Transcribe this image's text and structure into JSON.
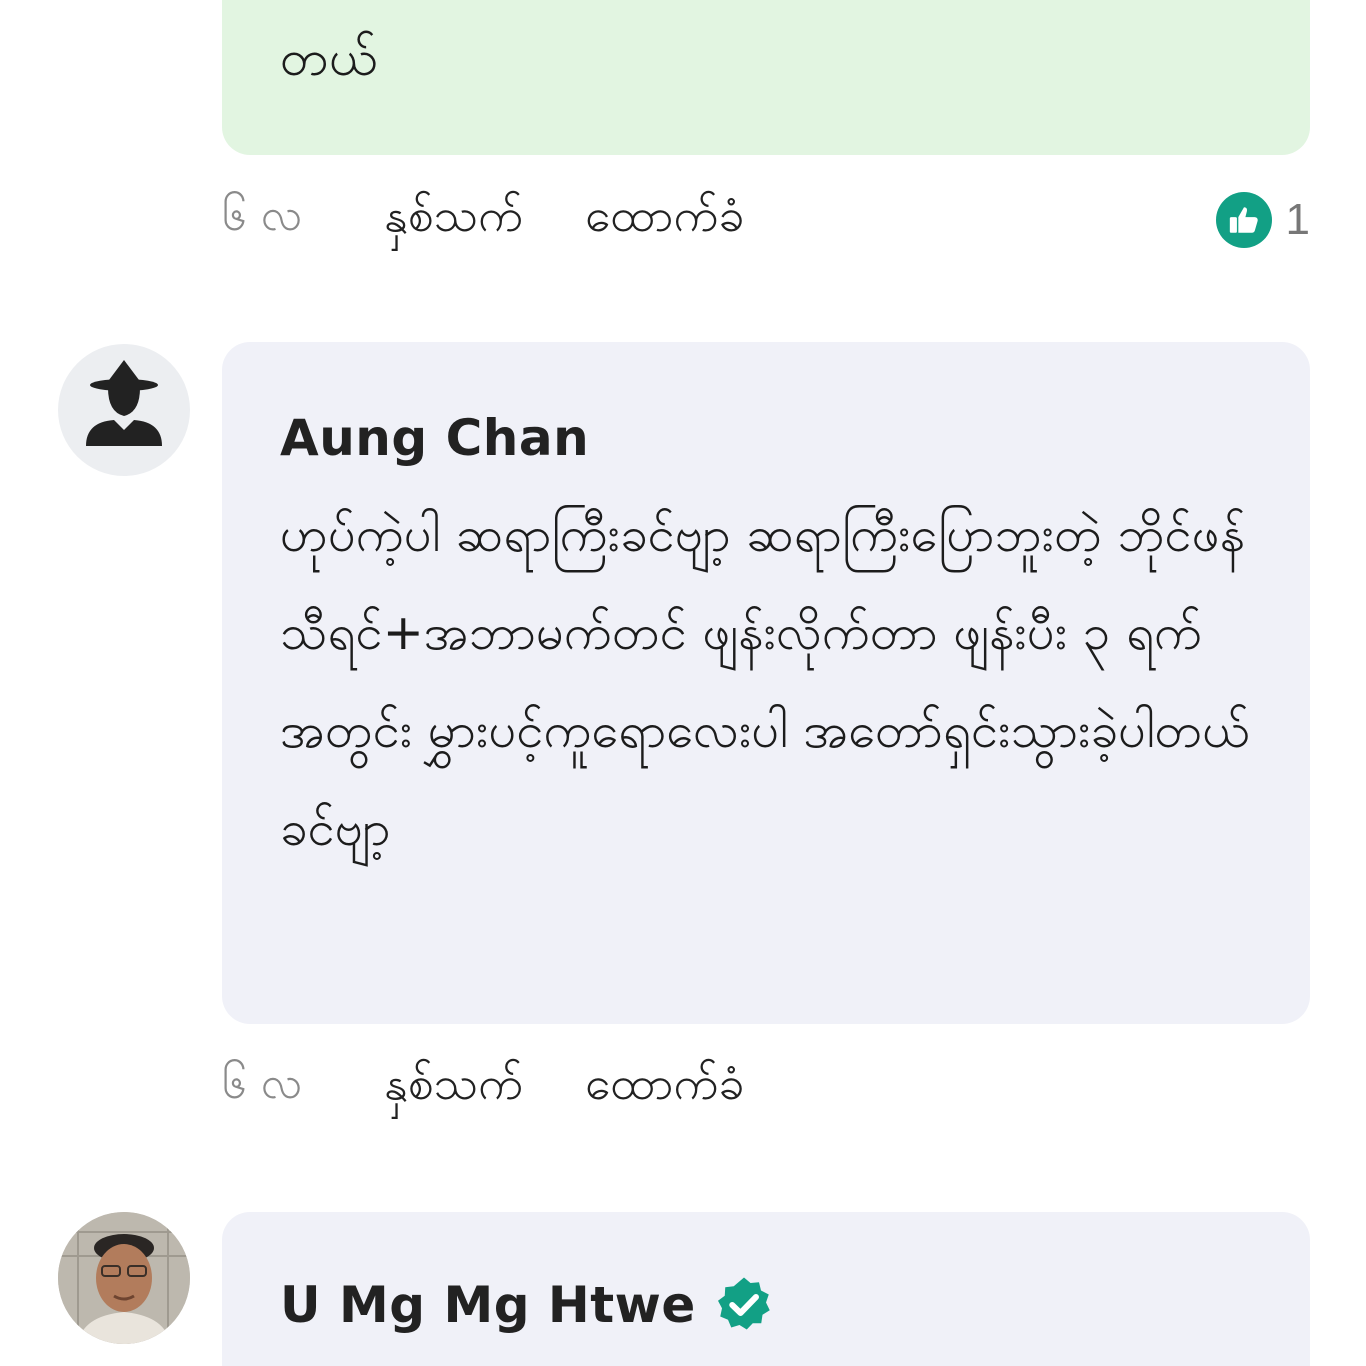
{
  "previous_comment": {
    "text_tail": "တယ်",
    "meta": {
      "time": "၆ လ",
      "react_label": "နှစ်သက်",
      "reply_label": "ထောက်ခံ",
      "like_count": "1"
    }
  },
  "comments": [
    {
      "author": "Aung Chan",
      "avatar": "default-user-icon",
      "text": "ဟုပ်ကဲ့ပါ ဆရာကြီးခင်ဗျာ့ ဆရာကြီးပြောဘူးတဲ့ ဘိုင်ဖန်သီရင်+အဘာမက်တင် ဖျန်းလိုက်တာ ဖျန်းပီး ၃ ရက်အတွင်း မွှားပင့်ကူရောလေးပါ အတော်ရှင်းသွားခဲ့ပါတယ်ခင်ဗျာ့",
      "meta": {
        "time": "၆ လ",
        "react_label": "နှစ်သက်",
        "reply_label": "ထောက်ခံ"
      }
    },
    {
      "author": "U Mg Mg Htwe",
      "avatar": "profile-photo",
      "verified": true,
      "verified_icon": "verified-badge-icon"
    }
  ],
  "colors": {
    "green_bubble": "#e2f5e1",
    "grey_bubble": "#f0f1f8",
    "like_accent": "#12a085",
    "verified_accent": "#12a085",
    "muted_text": "#8a8a8a"
  }
}
